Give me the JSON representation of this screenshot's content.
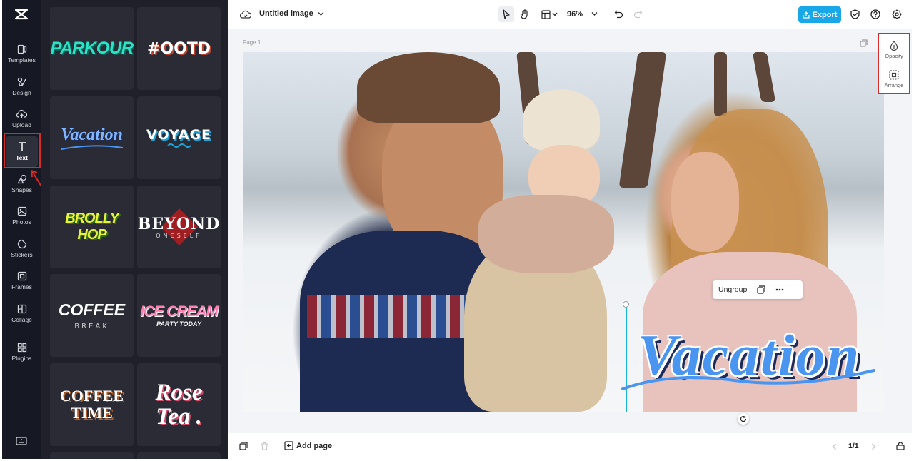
{
  "rail": {
    "items": [
      {
        "label": "Templates"
      },
      {
        "label": "Design"
      },
      {
        "label": "Upload"
      },
      {
        "label": "Text"
      },
      {
        "label": "Shapes"
      },
      {
        "label": "Photos"
      },
      {
        "label": "Stickers"
      },
      {
        "label": "Frames"
      },
      {
        "label": "Collage"
      },
      {
        "label": "Plugins"
      }
    ],
    "active": "Text"
  },
  "panel": {
    "tiles": [
      {
        "text": "PARKOUR"
      },
      {
        "text": "#OOTD"
      },
      {
        "text": "Vacation"
      },
      {
        "text": "VOYAGE"
      },
      {
        "text": "BROLLY HOP"
      },
      {
        "text": "BEYOND",
        "sub": "ONESELF"
      },
      {
        "text": "COFFEE",
        "sub": "BREAK"
      },
      {
        "text": "ICE CREAM",
        "sub": "PARTY TODAY"
      },
      {
        "line1": "COFFEE",
        "line2": "TIME"
      },
      {
        "line1": "Rose",
        "line2": "Tea ."
      }
    ]
  },
  "topbar": {
    "title": "Untitled image",
    "zoom": "96%",
    "export_label": "Export"
  },
  "canvas": {
    "page_label": "Page 1",
    "toolbar": {
      "ungroup_label": "Ungroup"
    },
    "text_element": "Vacation"
  },
  "right_panel": {
    "opacity_label": "Opacity",
    "arrange_label": "Arrange"
  },
  "bottombar": {
    "add_page_label": "Add page",
    "page_count": "1/1"
  },
  "colors": {
    "accent": "#19a7e8",
    "sidebar_bg": "#161823",
    "panel_bg": "#1f2029",
    "highlight": "#d62b2b",
    "selection": "#17b5d6"
  }
}
